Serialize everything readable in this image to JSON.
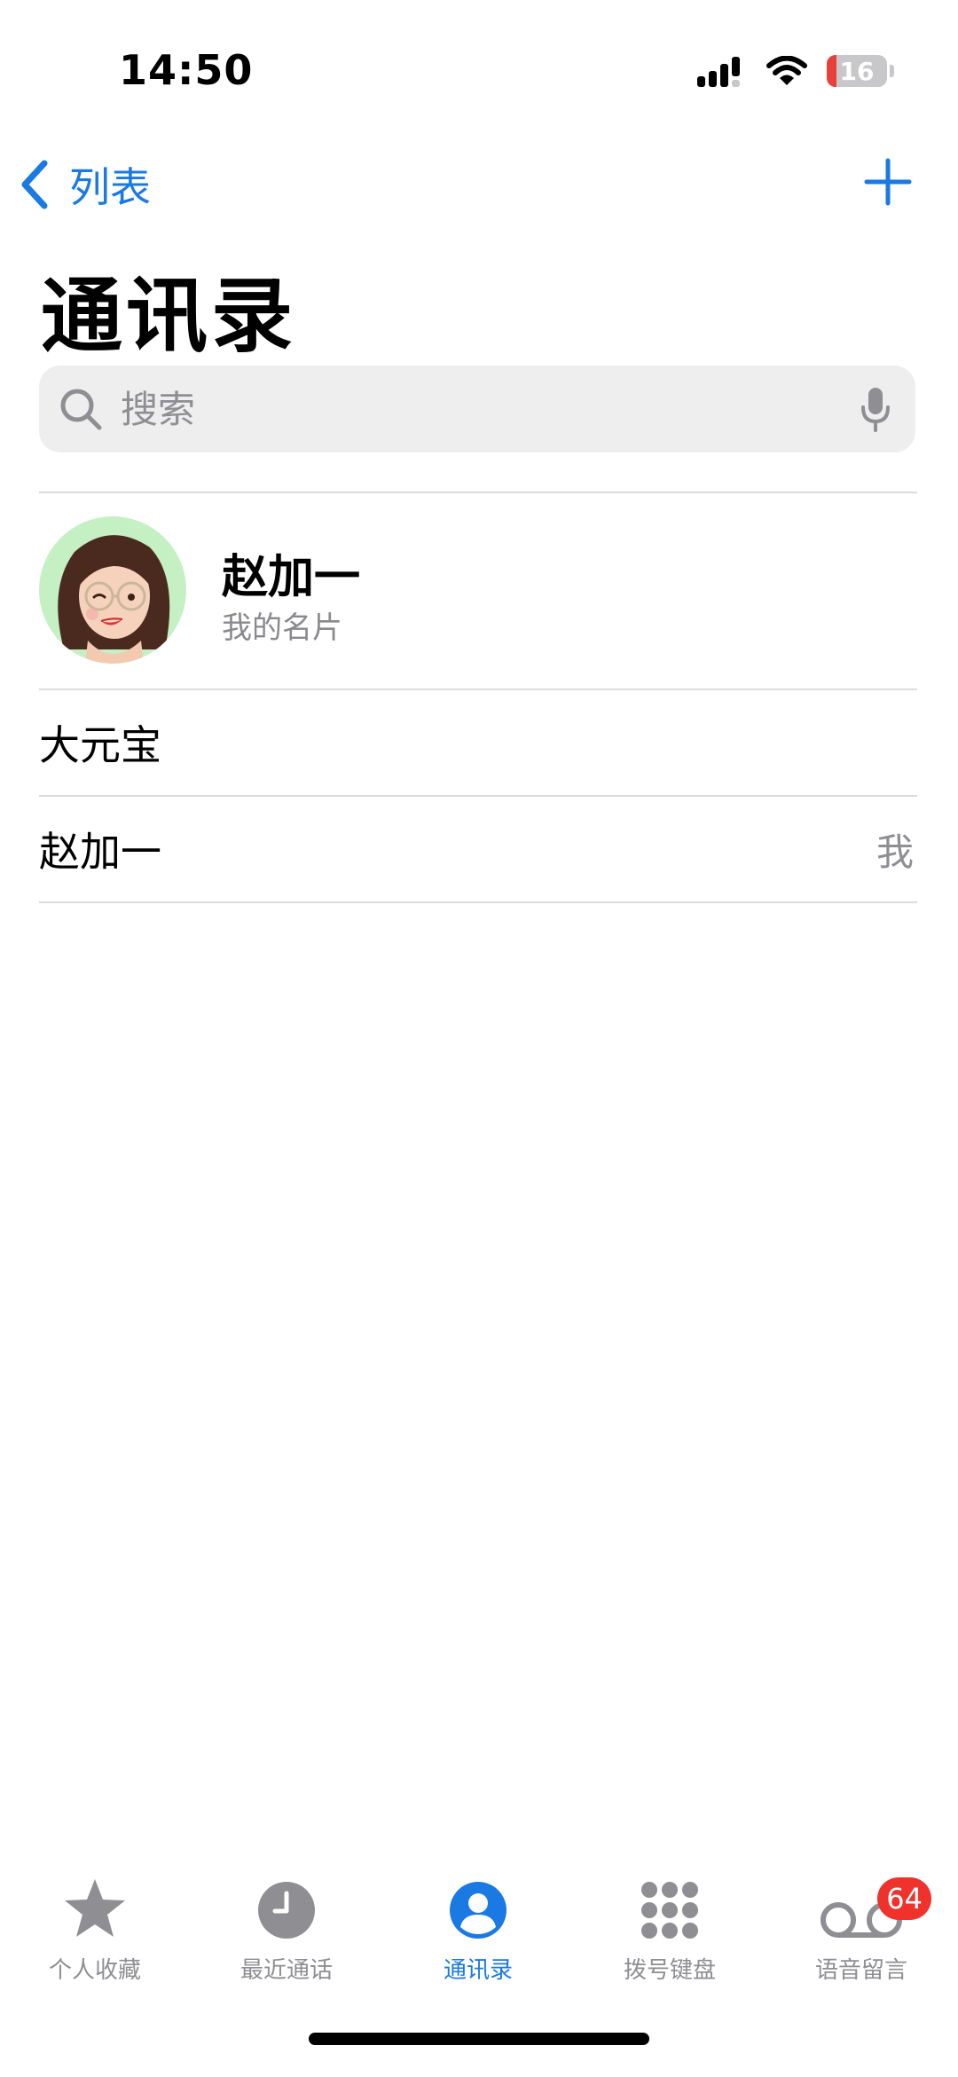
{
  "status_bar": {
    "time": "14:50",
    "battery_level": "16",
    "icons": [
      "cellular-signal-icon",
      "wifi-icon",
      "battery-icon"
    ]
  },
  "nav": {
    "back_label": "列表",
    "add_icon": "plus-icon"
  },
  "page_title": "通讯录",
  "search": {
    "placeholder": "搜索",
    "value": ""
  },
  "my_card": {
    "name": "赵加一",
    "subtitle": "我的名片"
  },
  "contacts": [
    {
      "name": "大元宝",
      "tag": ""
    },
    {
      "name": "赵加一",
      "tag": "我"
    }
  ],
  "tab_bar": {
    "tabs": [
      {
        "label": "个人收藏",
        "icon": "star-icon",
        "active": false
      },
      {
        "label": "最近通话",
        "icon": "clock-icon",
        "active": false
      },
      {
        "label": "通讯录",
        "icon": "person-circle-icon",
        "active": true
      },
      {
        "label": "拨号键盘",
        "icon": "keypad-icon",
        "active": false
      },
      {
        "label": "语音留言",
        "icon": "voicemail-icon",
        "active": false,
        "badge": "64"
      }
    ]
  },
  "colors": {
    "accent": "#1a79e3",
    "badge": "#f0322c",
    "avatar_bg": "#c5f0c4",
    "battery_low": "#e8403a"
  }
}
